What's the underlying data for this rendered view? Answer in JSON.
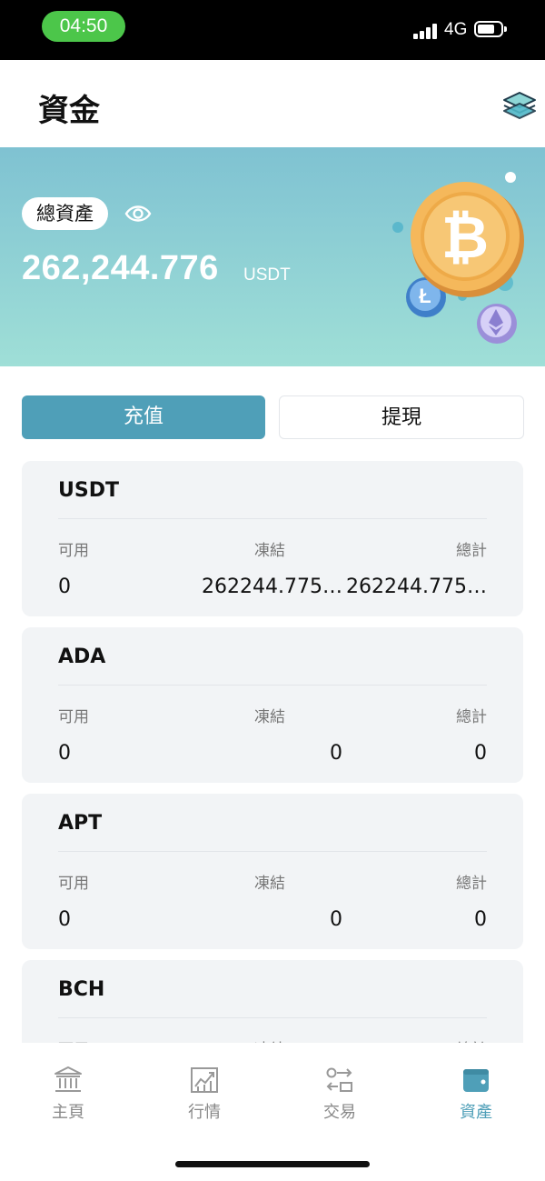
{
  "status_bar": {
    "time": "04:50",
    "network": "4G"
  },
  "header": {
    "title": "資金"
  },
  "summary": {
    "badge": "總資產",
    "total": "262,244.776",
    "unit": "USDT"
  },
  "actions": {
    "deposit": "充值",
    "withdraw": "提現"
  },
  "columns": {
    "available": "可用",
    "frozen": "凍結",
    "total": "總計"
  },
  "assets": [
    {
      "symbol": "USDT",
      "available": "0",
      "frozen": "262244.775…",
      "total": "262244.775…"
    },
    {
      "symbol": "ADA",
      "available": "0",
      "frozen": "0",
      "total": "0"
    },
    {
      "symbol": "APT",
      "available": "0",
      "frozen": "0",
      "total": "0"
    },
    {
      "symbol": "BCH",
      "available": "",
      "frozen": "",
      "total": ""
    }
  ],
  "nav": [
    {
      "label": "主頁",
      "icon": "bank-icon"
    },
    {
      "label": "行情",
      "icon": "chart-icon"
    },
    {
      "label": "交易",
      "icon": "exchange-icon"
    },
    {
      "label": "資產",
      "icon": "wallet-icon",
      "active": true
    }
  ],
  "colors": {
    "accent": "#4f9fb8",
    "hero_top": "#7fc2d2",
    "hero_bottom": "#9fdfd7",
    "card": "#f2f4f6"
  }
}
